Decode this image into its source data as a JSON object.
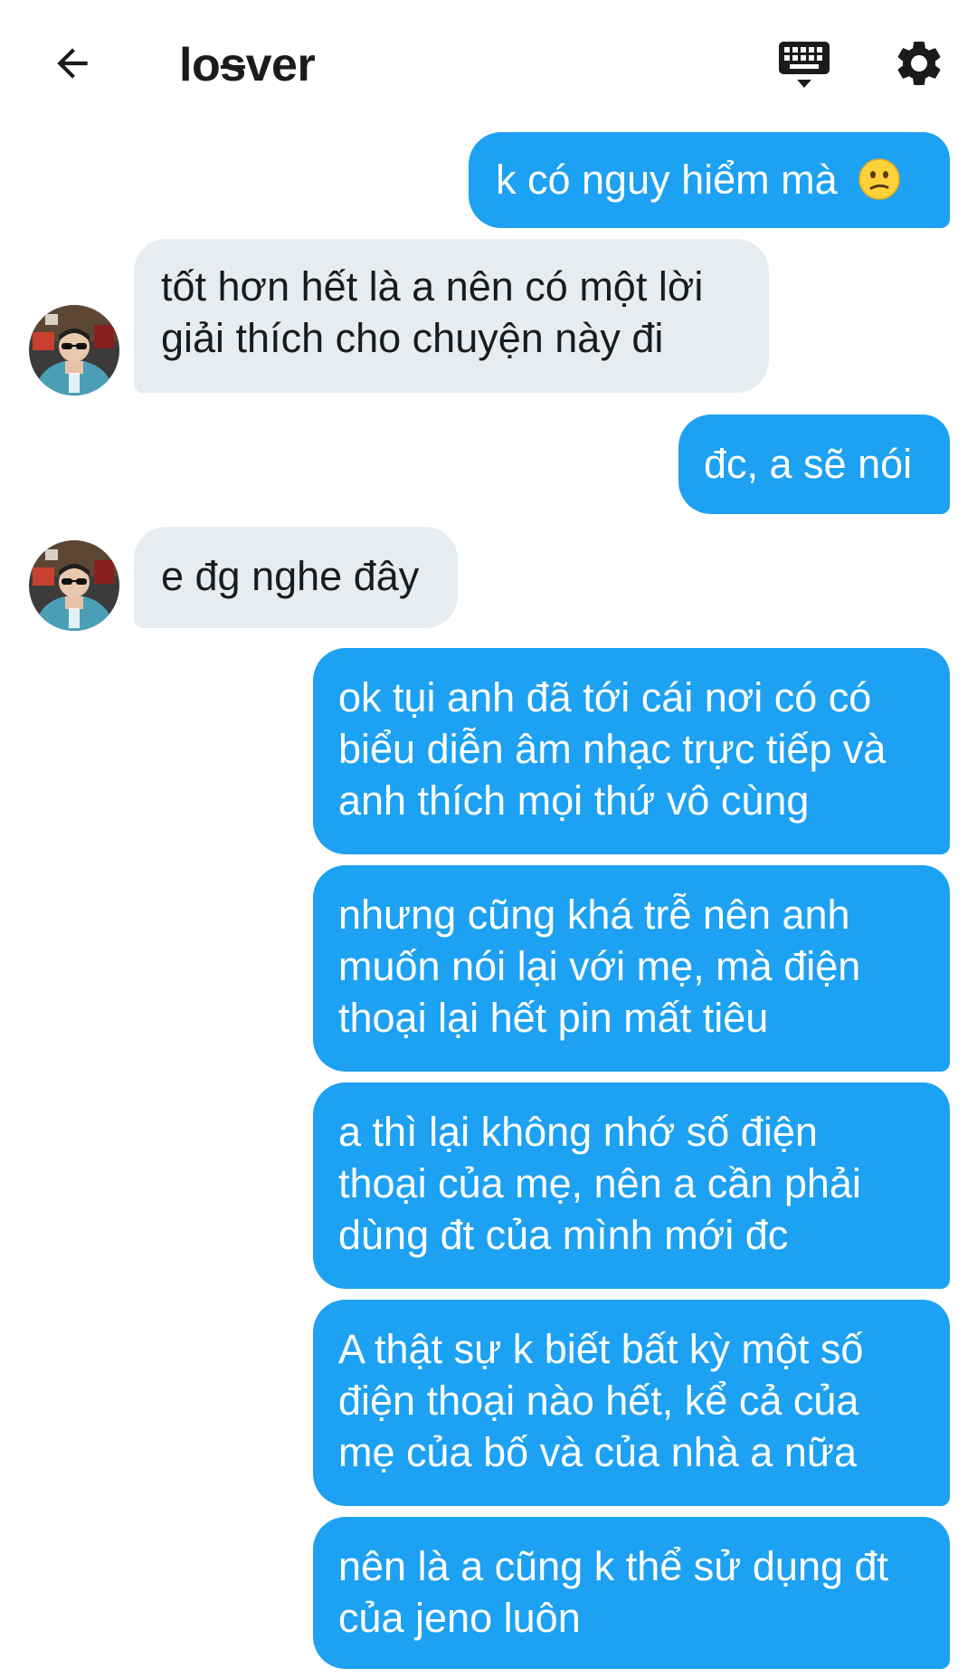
{
  "header": {
    "title_prefix": "lo",
    "title_strike": "s",
    "title_suffix": "ver",
    "back_icon": "arrow-left-icon",
    "keyboard_icon": "keyboard-icon",
    "settings_icon": "gear-icon"
  },
  "colors": {
    "outgoing_bubble": "#1da1f2",
    "incoming_bubble": "#e6ecf0"
  },
  "messages": [
    {
      "direction": "out",
      "text": "k có nguy hiểm mà",
      "emoji": "confused-face-emoji"
    },
    {
      "direction": "in",
      "lines": [
        "tốt hơn hết là a nên có một lời",
        "giải thích cho chuyện này đi"
      ]
    },
    {
      "direction": "out",
      "text": "đc, a sẽ nói"
    },
    {
      "direction": "in",
      "text": "e đg nghe đây"
    },
    {
      "direction": "out",
      "lines": [
        "ok tụi anh đã tới cái nơi có có",
        "biểu diễn âm nhạc trực tiếp và",
        "anh thích mọi thứ vô cùng"
      ]
    },
    {
      "direction": "out",
      "lines": [
        "nhưng cũng khá trễ nên anh",
        "muốn nói lại với mẹ, mà điện",
        "thoại lại hết pin mất tiêu"
      ]
    },
    {
      "direction": "out",
      "lines": [
        "a thì lại không nhớ số điện",
        "thoại của mẹ, nên a cần phải",
        "dùng đt của mình mới đc"
      ]
    },
    {
      "direction": "out",
      "lines": [
        "A thật sự k biết bất kỳ một số",
        "điện thoại nào hết, kể cả của",
        "mẹ của bố và của nhà a nữa"
      ]
    },
    {
      "direction": "out",
      "lines": [
        "nên là a cũng k thể sử dụng đt",
        "của jeno luôn"
      ]
    }
  ]
}
